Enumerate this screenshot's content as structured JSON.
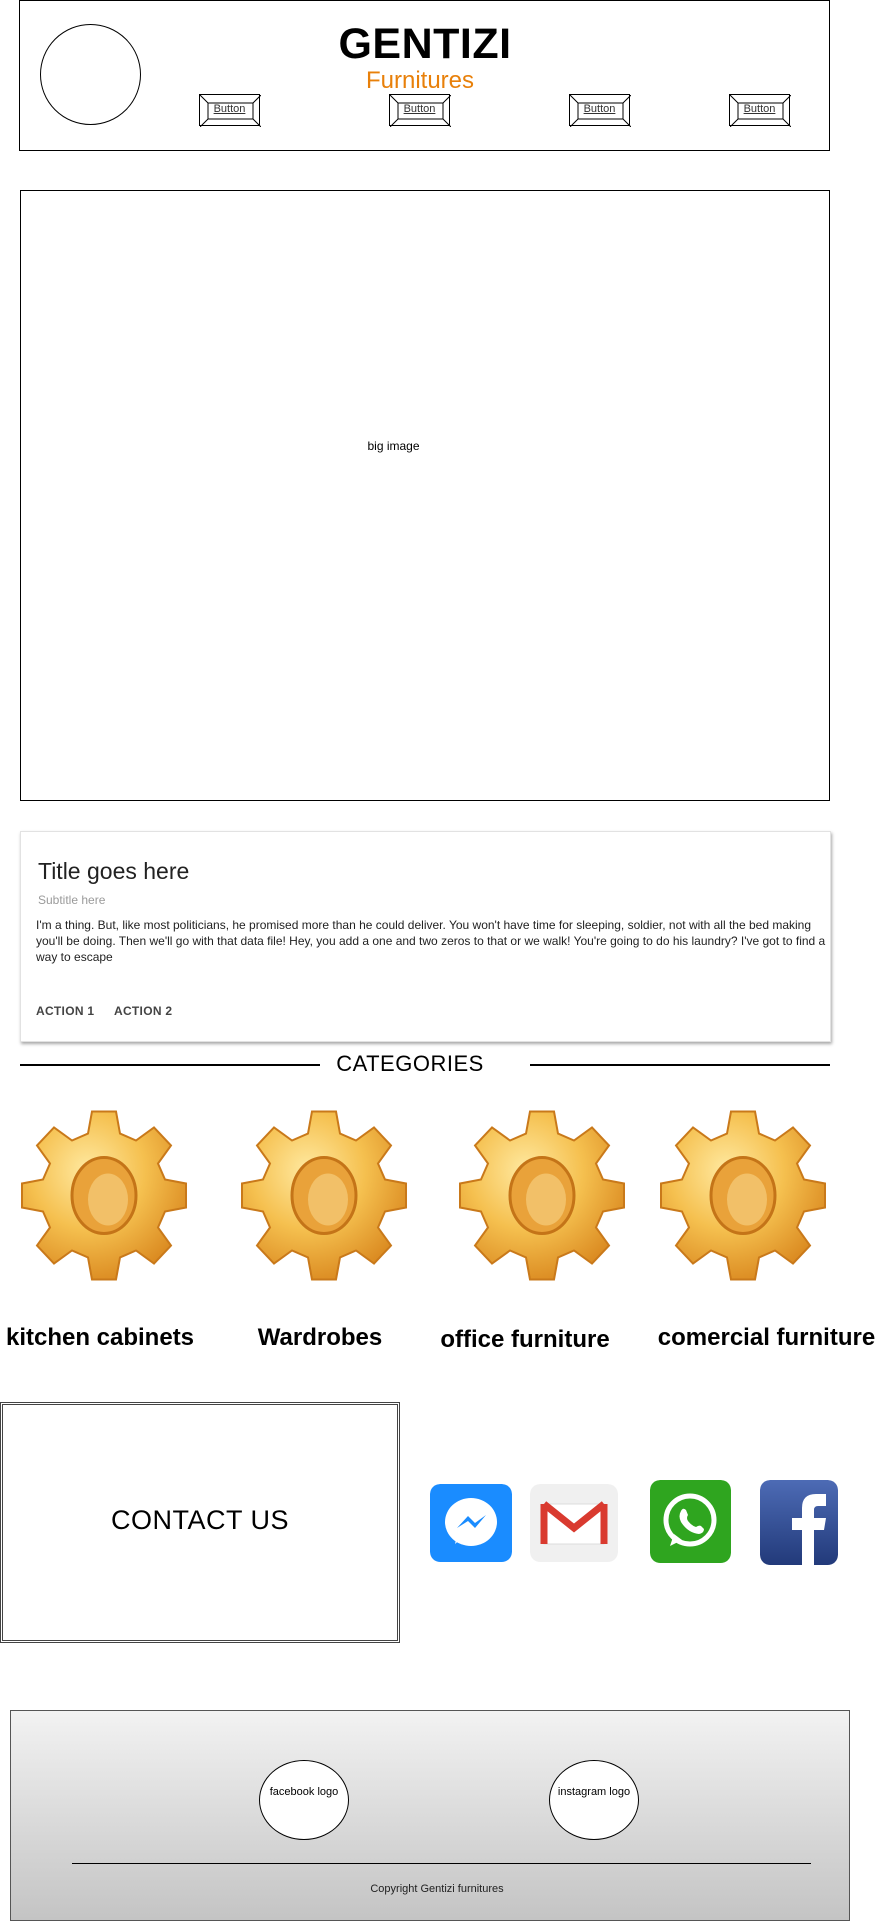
{
  "header": {
    "brand": "GENTIZI",
    "brand_sub": "Furnitures",
    "buttons": [
      "Button",
      "Button",
      "Button",
      "Button"
    ]
  },
  "hero": {
    "label": "big image"
  },
  "card": {
    "title": "Title goes here",
    "subtitle": "Subtitle here",
    "body": "I'm a thing. But, like most politicians, he promised more than he could deliver. You won't have time for sleeping, soldier, not with all the bed making you'll be doing. Then we'll go with that data file! Hey, you add a one and two zeros to that or we walk! You're going to do his laundry? I've got to find a way to escape",
    "actions": [
      "ACTION 1",
      "ACTION 2"
    ]
  },
  "categories": {
    "title": "CATEGORIES",
    "items": [
      {
        "label": "kitchen cabinets",
        "icon": "gear-icon"
      },
      {
        "label": "Wardrobes",
        "icon": "gear-icon"
      },
      {
        "label": "office furniture",
        "icon": "gear-icon"
      },
      {
        "label": "comercial furniture",
        "icon": "gear-icon"
      }
    ]
  },
  "contact": {
    "label": "CONTACT US",
    "social_icons": [
      "messenger-icon",
      "gmail-icon",
      "whatsapp-icon",
      "facebook-icon"
    ]
  },
  "footer": {
    "facebook_logo": "facebook logo",
    "instagram_logo": "instagram logo",
    "copyright": "Copyright Gentizi furnitures"
  },
  "colors": {
    "brand_accent": "#e8800a",
    "messenger": "#1a8cff",
    "whatsapp": "#2fa51f",
    "facebook": "#2c4a94"
  }
}
